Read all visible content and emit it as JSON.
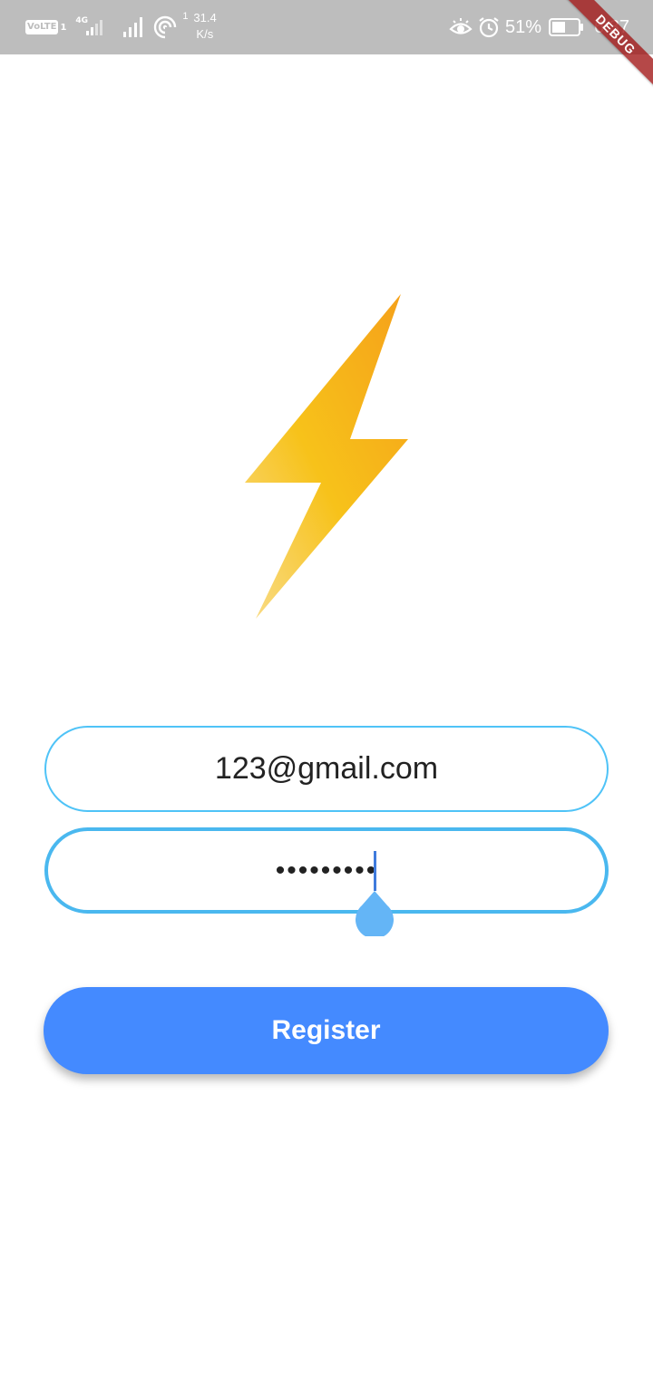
{
  "status_bar": {
    "volte_label": "VoLTE",
    "volte_sim": "1",
    "network_type": "4G",
    "speed_sup": "1",
    "speed_value": "31.4",
    "speed_unit": "K/s",
    "battery_percent": "51%",
    "battery_level": 0.51,
    "time": "6:37",
    "background_color": "#bdbdbd"
  },
  "debug_banner": {
    "label": "DEBUG",
    "color": "#a01414"
  },
  "logo": {
    "icon": "lightning-bolt-icon",
    "colors": [
      "#f5a01a",
      "#f7c21a",
      "#f9d77a"
    ]
  },
  "form": {
    "email": {
      "value": "123@gmail.com",
      "border_color": "#4fc3f7"
    },
    "password": {
      "value": "•••••••••",
      "border_color": "#4ab8ef",
      "focused": true
    },
    "register_label": "Register",
    "register_color": "#448aff"
  }
}
